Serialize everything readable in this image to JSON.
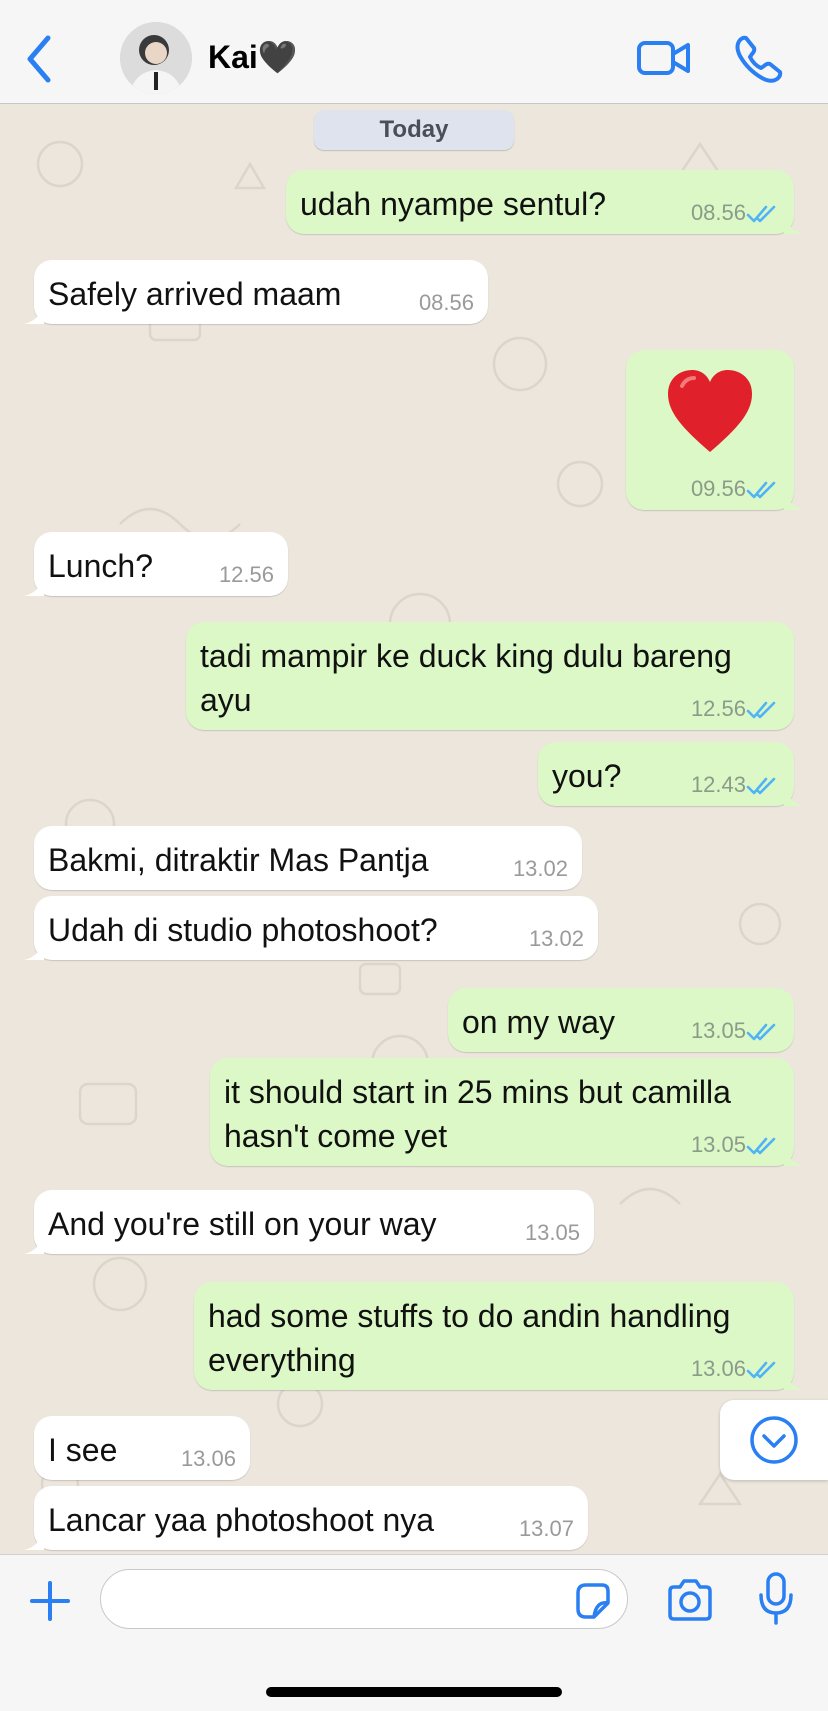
{
  "header": {
    "contact_name": "Kai🖤",
    "icons": {
      "back": "chevron-left-icon",
      "video": "video-camera-icon",
      "call": "phone-icon"
    },
    "accent_color": "#2a7ff3"
  },
  "chat": {
    "date_label": "Today",
    "messages": [
      {
        "direction": "out",
        "text": "udah nyampe sentul?",
        "time": "08.56",
        "status": "read"
      },
      {
        "direction": "in",
        "text": "Safely arrived maam",
        "time": "08.56"
      },
      {
        "direction": "out",
        "text": "❤️",
        "time": "09.56",
        "status": "read",
        "kind": "emoji"
      },
      {
        "direction": "in",
        "text": "Lunch?",
        "time": "12.56"
      },
      {
        "direction": "out",
        "text": "tadi mampir ke duck king dulu bareng\nayu",
        "time": "12.56",
        "status": "read"
      },
      {
        "direction": "out",
        "text": "you?",
        "time": "12.43",
        "status": "read"
      },
      {
        "direction": "in",
        "text": "Bakmi, ditraktir Mas Pantja",
        "time": "13.02"
      },
      {
        "direction": "in",
        "text": "Udah di studio photoshoot?",
        "time": "13.02"
      },
      {
        "direction": "out",
        "text": "on my way",
        "time": "13.05",
        "status": "read"
      },
      {
        "direction": "out",
        "text": "it should start in 25 mins but camilla\nhasn't come yet",
        "time": "13.05",
        "status": "read"
      },
      {
        "direction": "in",
        "text": "And you're still on your way",
        "time": "13.05"
      },
      {
        "direction": "out",
        "text": "had some stuffs to do andin handling\neverything",
        "time": "13.06",
        "status": "read"
      },
      {
        "direction": "in",
        "text": "I see",
        "time": "13.06"
      },
      {
        "direction": "in",
        "text": "Lancar yaa photoshoot nya",
        "time": "13.07"
      }
    ],
    "colors": {
      "incoming_bubble": "#ffffff",
      "outgoing_bubble": "#dcf8c6",
      "read_ticks": "#4fb4f5",
      "heart": "#e0202a"
    }
  },
  "input_bar": {
    "value": "",
    "icons": {
      "plus": "plus-icon",
      "sticker": "sticker-icon",
      "camera": "camera-icon",
      "mic": "microphone-icon"
    }
  }
}
